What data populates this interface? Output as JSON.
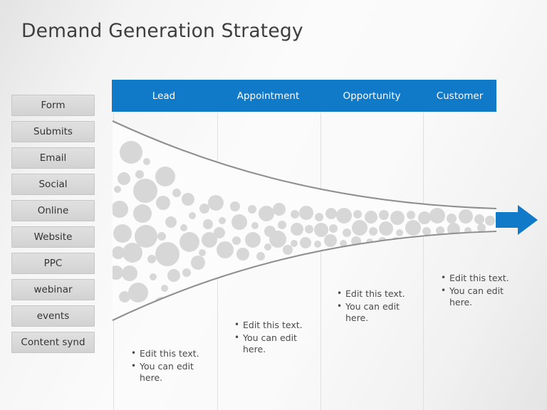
{
  "slide": {
    "title": "Demand Generation Strategy",
    "background_color": "#f5f5f5",
    "accent_color": "#1079c8",
    "funnel_fill_color": "#fbfbfb",
    "funnel_stroke_color": "#8c8c8c",
    "bubble_color": "#d6d6d6",
    "sidebar_button_color": "#d9d9d9"
  },
  "sidebar": {
    "items": [
      {
        "label": "Form"
      },
      {
        "label": "Submits"
      },
      {
        "label": "Email"
      },
      {
        "label": "Social"
      },
      {
        "label": "Online"
      },
      {
        "label": "Website"
      },
      {
        "label": "PPC"
      },
      {
        "label": "webinar"
      },
      {
        "label": "events"
      },
      {
        "label": "Content synd"
      }
    ]
  },
  "header": {
    "columns": [
      {
        "label": "Lead"
      },
      {
        "label": "Appointment"
      },
      {
        "label": "Opportunity"
      },
      {
        "label": "Customer"
      }
    ]
  },
  "content": {
    "blocks": [
      {
        "stage": "Lead",
        "bullets": [
          "Edit this text.",
          "You can edit here."
        ]
      },
      {
        "stage": "Appointment",
        "bullets": [
          "Edit this text.",
          "You can edit here."
        ]
      },
      {
        "stage": "Opportunity",
        "bullets": [
          "Edit this text.",
          "You can edit here."
        ]
      },
      {
        "stage": "Customer",
        "bullets": [
          "Edit this text.",
          "You can edit here."
        ]
      }
    ]
  },
  "arrow": {
    "label": "flow-arrow",
    "color": "#1079c8"
  }
}
